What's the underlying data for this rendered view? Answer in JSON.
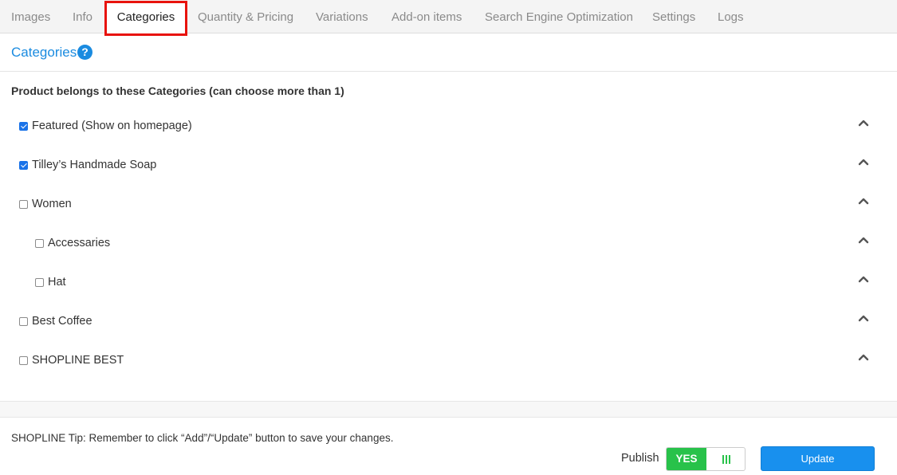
{
  "tabs": [
    {
      "label": "Images"
    },
    {
      "label": "Info"
    },
    {
      "label": "Categories"
    },
    {
      "label": "Quantity & Pricing"
    },
    {
      "label": "Variations"
    },
    {
      "label": "Add-on items"
    },
    {
      "label": "Search Engine Optimization"
    },
    {
      "label": "Settings"
    },
    {
      "label": "Logs"
    }
  ],
  "active_tab": "Categories",
  "section": {
    "title": "Categories",
    "help_icon": "question-circle-icon",
    "help_glyph": "?"
  },
  "categories": {
    "group_label": "Product belongs to these Categories (can choose more than 1)",
    "items": [
      {
        "label": "Featured (Show on homepage)",
        "checked": true,
        "level": 0
      },
      {
        "label": "Tilley’s Handmade Soap",
        "checked": true,
        "level": 0
      },
      {
        "label": "Women",
        "checked": false,
        "level": 0
      },
      {
        "label": "Accessaries",
        "checked": false,
        "level": 1
      },
      {
        "label": "Hat",
        "checked": false,
        "level": 1
      },
      {
        "label": "Best Coffee",
        "checked": false,
        "level": 0
      },
      {
        "label": "SHOPLINE BEST",
        "checked": false,
        "level": 0
      }
    ],
    "row_icon": "chevron-up-icon"
  },
  "footer": {
    "tip": "SHOPLINE Tip: Remember to click “Add”/“Update” button to save your changes.",
    "publish_label": "Publish",
    "publish_toggle": {
      "value": "YES",
      "on": true
    },
    "update_label": "Update"
  },
  "colors": {
    "accent": "#1a8be0",
    "active_tab_outline": "#e8120c",
    "toggle_green": "#28c24a",
    "update_button": "#1890ee",
    "checkbox_checked": "#1a73e8"
  }
}
